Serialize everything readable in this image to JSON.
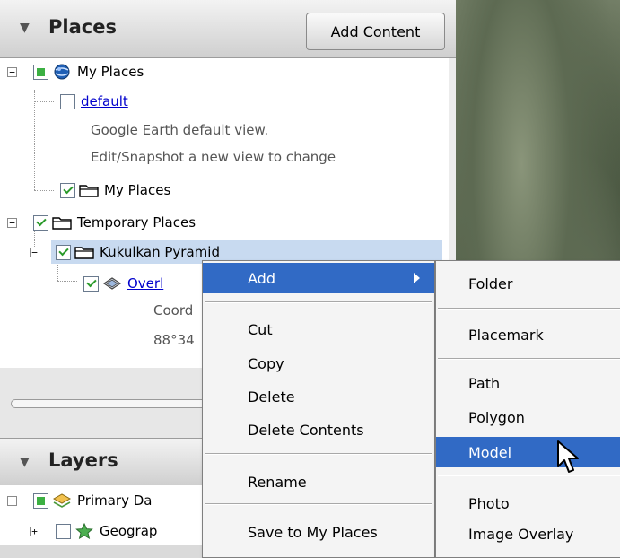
{
  "places": {
    "title": "Places",
    "add_content": "Add Content",
    "tree": {
      "my_places_root": "My Places",
      "default_link": "default",
      "default_desc_1": "Google Earth default view.",
      "default_desc_2": "Edit/Snapshot a new view to change",
      "my_places_folder": "My Places",
      "temporary_places": "Temporary Places",
      "kukulkan": "Kukulkan Pyramid",
      "overlay_link": "Overl",
      "overlay_desc_1": "Coord",
      "overlay_desc_2": "88°34"
    }
  },
  "layers": {
    "title": "Layers",
    "items": [
      "Primary Da",
      "Geograp"
    ]
  },
  "context_menu": {
    "items": [
      "Add",
      "Cut",
      "Copy",
      "Delete",
      "Delete Contents",
      "Rename",
      "Save to My Places"
    ]
  },
  "submenu": {
    "items": [
      "Folder",
      "Placemark",
      "Path",
      "Polygon",
      "Model",
      "Photo",
      "Image Overlay"
    ]
  },
  "colors": {
    "menu_highlight": "#316ac5",
    "selection": "#c8daf0",
    "link": "#0000cc"
  }
}
